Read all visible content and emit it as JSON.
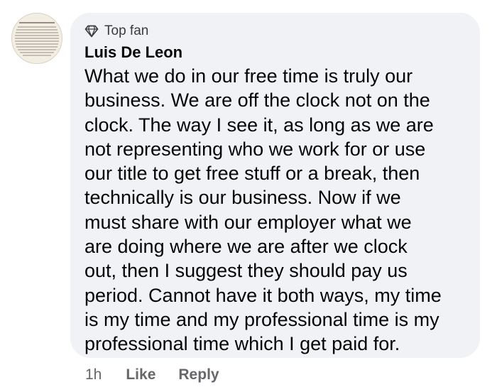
{
  "comment": {
    "avatar_icon": "newspaper-clipping-avatar",
    "badge": {
      "icon": "diamond-icon",
      "label": "Top fan"
    },
    "author": "Luis De Leon",
    "lines": [
      "What we do in our free time is truly our",
      "business. We are off the clock not on the",
      "clock. The way I see it, as long as we are",
      "not representing who we work for or use",
      "our title to get free stuff or a break, then",
      "technically is our business. Now if we",
      "must share with our employer what we",
      "are doing where we are after we clock",
      "out, then I suggest they should pay us",
      "period. Cannot have it both ways, my time",
      "is my time and my professional time is my",
      "professional time which I get paid for."
    ],
    "bubble_color": "#f0f2f5"
  },
  "actions": {
    "time": "1h",
    "like_label": "Like",
    "reply_label": "Reply"
  }
}
